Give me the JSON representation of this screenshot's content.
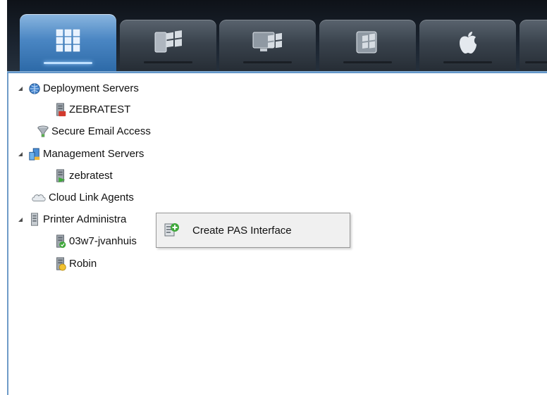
{
  "toolbar": {
    "tabs": [
      {
        "icon": "grid-icon",
        "active": true
      },
      {
        "icon": "windows-mobile-icon",
        "active": false
      },
      {
        "icon": "windows-desktop-icon",
        "active": false
      },
      {
        "icon": "windows-tablet-icon",
        "active": false
      },
      {
        "icon": "apple-icon",
        "active": false
      },
      {
        "icon": "partial-tab-icon",
        "active": false
      }
    ]
  },
  "tree": {
    "items": [
      {
        "label": "Deployment Servers",
        "icon": "globe-server-icon",
        "expanded": true
      },
      {
        "label": "ZEBRATEST",
        "icon": "server-red-icon"
      },
      {
        "label": "Secure Email Access",
        "icon": "funnel-icon"
      },
      {
        "label": "Management Servers",
        "icon": "management-server-icon",
        "expanded": true
      },
      {
        "label": "zebratest",
        "icon": "server-green-icon"
      },
      {
        "label": "Cloud Link Agents",
        "icon": "cloud-icon"
      },
      {
        "label": "Printer Administra",
        "icon": "printer-server-icon",
        "expanded": true
      },
      {
        "label": "03w7-jvanhuis",
        "icon": "server-green-check-icon"
      },
      {
        "label": "Robin",
        "icon": "server-yellow-icon"
      }
    ]
  },
  "context_menu": {
    "items": [
      {
        "label": "Create PAS Interface",
        "icon": "create-interface-icon"
      }
    ]
  },
  "colors": {
    "tab_active": "#4a86c3",
    "tab_inactive": "#3a434d",
    "border_blue": "#6f9bc8",
    "menu_bg": "#f0f0f0"
  }
}
